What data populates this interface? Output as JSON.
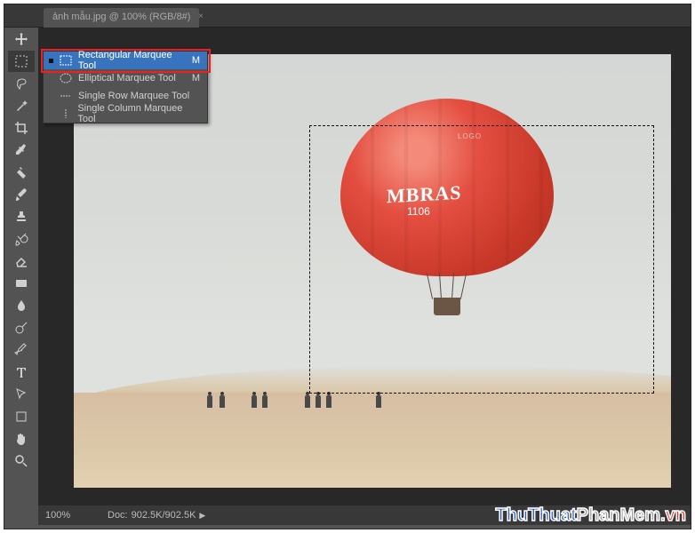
{
  "topbar": {
    "tab_title": "ảnh mẫu.jpg @ 100% (RGB/8#)",
    "tab_close": "×",
    "app_label": ""
  },
  "tools": [
    {
      "name": "move-tool",
      "icon": "move"
    },
    {
      "name": "marquee-tool",
      "icon": "marquee",
      "active": true
    },
    {
      "name": "lasso-tool",
      "icon": "lasso"
    },
    {
      "name": "wand-tool",
      "icon": "wand"
    },
    {
      "name": "crop-tool",
      "icon": "crop"
    },
    {
      "name": "eyedropper-tool",
      "icon": "eyedropper"
    },
    {
      "name": "heal-tool",
      "icon": "heal"
    },
    {
      "name": "brush-tool",
      "icon": "brush"
    },
    {
      "name": "stamp-tool",
      "icon": "stamp"
    },
    {
      "name": "history-brush-tool",
      "icon": "historybrush"
    },
    {
      "name": "eraser-tool",
      "icon": "eraser"
    },
    {
      "name": "gradient-tool",
      "icon": "gradient"
    },
    {
      "name": "blur-tool",
      "icon": "blur"
    },
    {
      "name": "dodge-tool",
      "icon": "dodge"
    },
    {
      "name": "pen-tool",
      "icon": "pen"
    },
    {
      "name": "type-tool",
      "icon": "type"
    },
    {
      "name": "path-select-tool",
      "icon": "pathselect"
    },
    {
      "name": "shape-tool",
      "icon": "shape"
    },
    {
      "name": "hand-tool",
      "icon": "hand"
    },
    {
      "name": "zoom-tool",
      "icon": "zoom"
    }
  ],
  "flyout": {
    "items": [
      {
        "label": "Rectangular Marquee Tool",
        "shortcut": "M",
        "selected": true,
        "icon": "rect"
      },
      {
        "label": "Elliptical Marquee Tool",
        "shortcut": "M",
        "selected": false,
        "icon": "ellipse"
      },
      {
        "label": "Single Row Marquee Tool",
        "shortcut": "",
        "selected": false,
        "icon": "row"
      },
      {
        "label": "Single Column Marquee Tool",
        "shortcut": "",
        "selected": false,
        "icon": "col"
      }
    ]
  },
  "status": {
    "zoom": "100%",
    "doc_label": "Doc:",
    "doc_size": "902.5K/902.5K",
    "arrow": "▶"
  },
  "balloon": {
    "brand": "MBRAS",
    "number": "1106",
    "logo": "LOGO"
  },
  "watermark": {
    "a": "ThuThuat",
    "b": "PhanMem",
    "c": ".vn"
  }
}
